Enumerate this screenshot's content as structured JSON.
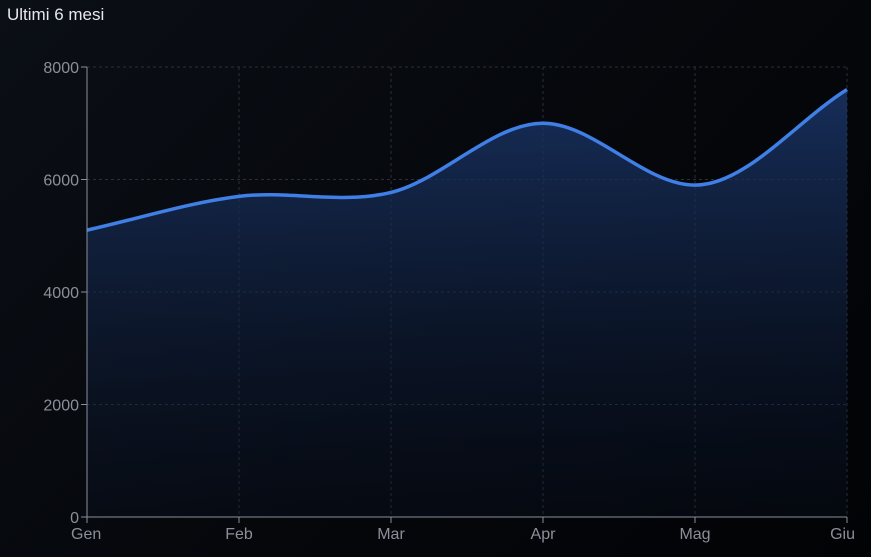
{
  "header": {
    "title": "Ultimi 6 mesi"
  },
  "chart_data": {
    "type": "area",
    "title": "Ultimi 6 mesi",
    "categories": [
      "Gen",
      "Feb",
      "Mar",
      "Apr",
      "Mag",
      "Giu"
    ],
    "series": [
      {
        "values": [
          5100,
          5700,
          5770,
          7000,
          5900,
          7600
        ]
      }
    ],
    "ylim": [
      0,
      8000
    ],
    "yticks": [
      0,
      2000,
      4000,
      6000,
      8000
    ],
    "xlabel": "",
    "ylabel": "",
    "grid": true,
    "colors": {
      "line": "#3f7fe6",
      "fill_top": "#17305e",
      "grid": "#2a2f38",
      "axis": "#8a8f99"
    }
  }
}
